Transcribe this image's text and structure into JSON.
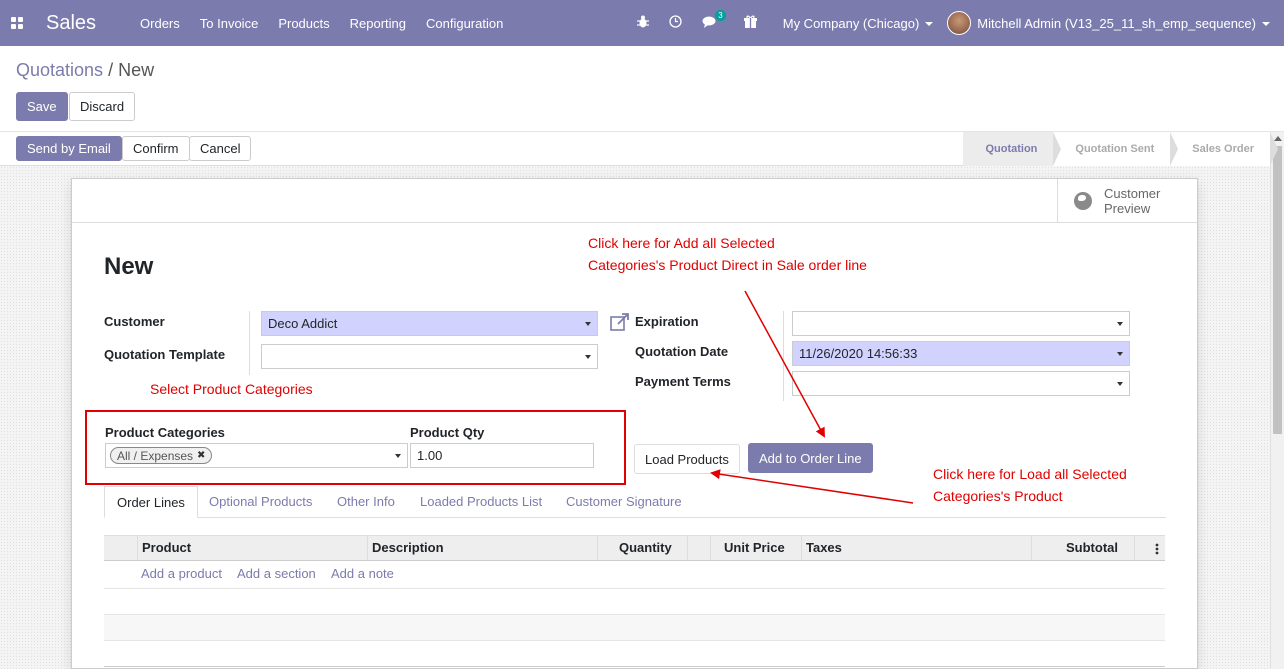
{
  "navbar": {
    "brand": "Sales",
    "menu": [
      "Orders",
      "To Invoice",
      "Products",
      "Reporting",
      "Configuration"
    ],
    "chat_count": "3",
    "company": "My Company (Chicago)",
    "user": "Mitchell Admin (V13_25_11_sh_emp_sequence)"
  },
  "breadcrumb": {
    "parent": "Quotations",
    "sep": " / ",
    "current": "New"
  },
  "controls": {
    "save": "Save",
    "discard": "Discard"
  },
  "header_buttons": {
    "send_email": "Send by Email",
    "confirm": "Confirm",
    "cancel": "Cancel"
  },
  "stages": [
    "Quotation",
    "Quotation Sent",
    "Sales Order"
  ],
  "smart_button": {
    "line1": "Customer",
    "line2": "Preview"
  },
  "form": {
    "title": "New",
    "customer_label": "Customer",
    "customer_value": "Deco Addict",
    "template_label": "Quotation Template",
    "template_value": "",
    "expiration_label": "Expiration",
    "expiration_value": "",
    "quotation_date_label": "Quotation Date",
    "quotation_date_value": "11/26/2020 14:56:33",
    "payment_terms_label": "Payment Terms",
    "payment_terms_value": "",
    "product_categories_label": "Product Categories",
    "product_categories_tag": "All / Expenses",
    "product_qty_label": "Product Qty",
    "product_qty_value": "1.00",
    "load_products": "Load Products",
    "add_to_order_line": "Add to Order Line"
  },
  "annotations": {
    "top_line1": "Click here for Add all Selected",
    "top_line2": "Categories's Product Direct in Sale order line",
    "select_categories": "Select Product Categories",
    "right_line1": "Click here for Load all Selected",
    "right_line2": "Categories's Product"
  },
  "tabs": [
    "Order Lines",
    "Optional Products",
    "Other Info",
    "Loaded Products List",
    "Customer Signature"
  ],
  "table": {
    "columns": [
      "Product",
      "Description",
      "Quantity",
      "Unit Price",
      "Taxes",
      "Subtotal"
    ],
    "add_product": "Add a product",
    "add_section": "Add a section",
    "add_note": "Add a note"
  },
  "colors": {
    "brand": "#7c7bad",
    "annotation": "#e00000",
    "required": "#d2d2ff"
  }
}
